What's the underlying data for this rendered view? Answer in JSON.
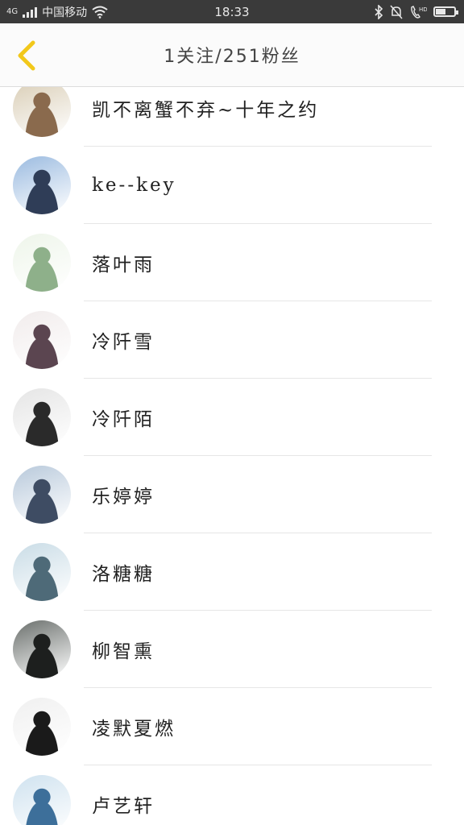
{
  "status_bar": {
    "network": "4G",
    "carrier": "中国移动",
    "time": "18:33",
    "right_icons": [
      "bluetooth-icon",
      "mute-icon",
      "hd-call-icon",
      "battery-icon"
    ],
    "battery_level": 0.55
  },
  "header": {
    "back_icon": "chevron-left-icon",
    "title": "1关注/251粉丝",
    "accent_color": "#f2c81b"
  },
  "fans": [
    {
      "name": "凯不离蟹不弃~十年之约",
      "avatar_colors": [
        "#d9cdb5",
        "#8a6a4d"
      ]
    },
    {
      "name": "ke--key",
      "avatar_colors": [
        "#9bbbe0",
        "#2f3d57"
      ]
    },
    {
      "name": "落叶雨",
      "avatar_colors": [
        "#eef5ea",
        "#8eb08a"
      ]
    },
    {
      "name": "冷阡雪",
      "avatar_colors": [
        "#f1ecec",
        "#5b4550"
      ]
    },
    {
      "name": "冷阡陌",
      "avatar_colors": [
        "#e5e5e5",
        "#2a2a2a"
      ]
    },
    {
      "name": "乐婷婷",
      "avatar_colors": [
        "#b8c9db",
        "#3e4c63"
      ]
    },
    {
      "name": "洛糖糖",
      "avatar_colors": [
        "#c9dce6",
        "#4e6a78"
      ]
    },
    {
      "name": "柳智熏",
      "avatar_colors": [
        "#6a6f6c",
        "#1d1f1e"
      ]
    },
    {
      "name": "凌默夏燃",
      "avatar_colors": [
        "#f0f0f0",
        "#1a1a1a"
      ]
    },
    {
      "name": "卢艺轩",
      "avatar_colors": [
        "#cfe2ef",
        "#3d6f9a"
      ]
    }
  ]
}
